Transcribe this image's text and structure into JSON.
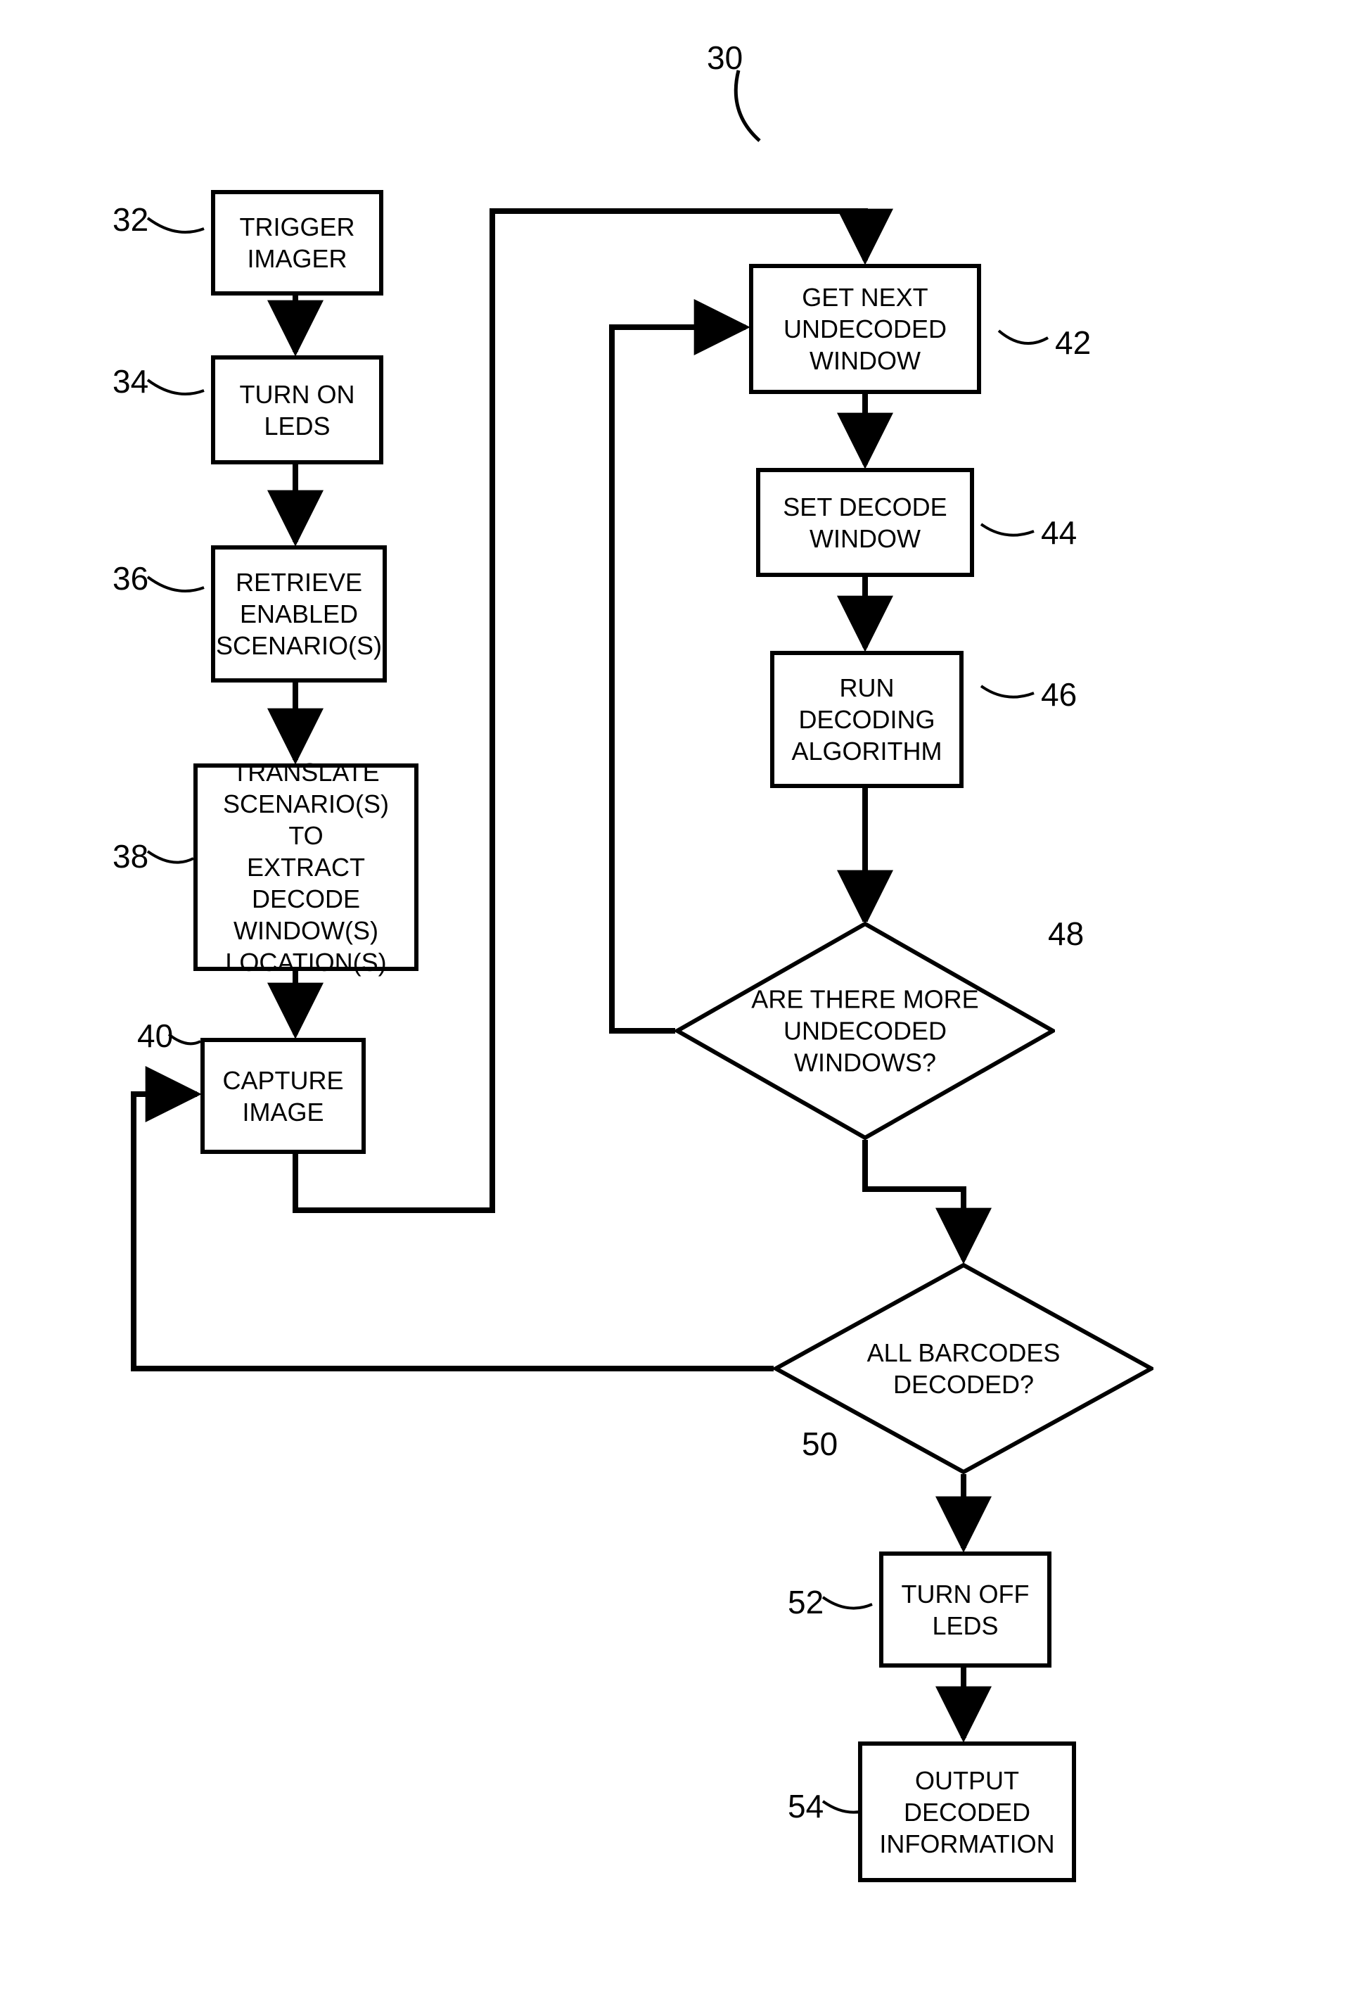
{
  "chart_data": {
    "type": "flowchart",
    "title_ref": "30",
    "nodes": [
      {
        "id": "n32",
        "ref": "32",
        "shape": "rect",
        "text": "TRIGGER IMAGER"
      },
      {
        "id": "n34",
        "ref": "34",
        "shape": "rect",
        "text": "TURN ON LEDS"
      },
      {
        "id": "n36",
        "ref": "36",
        "shape": "rect",
        "text": "RETRIEVE ENABLED SCENARIO(S)"
      },
      {
        "id": "n38",
        "ref": "38",
        "shape": "rect",
        "text": "TRANSLATE SCENARIO(S) TO EXTRACT DECODE WINDOW(S) LOCATION(S)"
      },
      {
        "id": "n40",
        "ref": "40",
        "shape": "rect",
        "text": "CAPTURE IMAGE"
      },
      {
        "id": "n42",
        "ref": "42",
        "shape": "rect",
        "text": "GET NEXT UNDECODED WINDOW"
      },
      {
        "id": "n44",
        "ref": "44",
        "shape": "rect",
        "text": "SET DECODE WINDOW"
      },
      {
        "id": "n46",
        "ref": "46",
        "shape": "rect",
        "text": "RUN DECODING ALGORITHM"
      },
      {
        "id": "n48",
        "ref": "48",
        "shape": "diamond",
        "text": "ARE THERE MORE UNDECODED WINDOWS?"
      },
      {
        "id": "n50",
        "ref": "50",
        "shape": "diamond",
        "text": "ALL BARCODES DECODED?"
      },
      {
        "id": "n52",
        "ref": "52",
        "shape": "rect",
        "text": "TURN OFF LEDS"
      },
      {
        "id": "n54",
        "ref": "54",
        "shape": "rect",
        "text": "OUTPUT DECODED INFORMATION"
      }
    ],
    "edges": [
      {
        "from": "n32",
        "to": "n34"
      },
      {
        "from": "n34",
        "to": "n36"
      },
      {
        "from": "n36",
        "to": "n38"
      },
      {
        "from": "n38",
        "to": "n40"
      },
      {
        "from": "n40",
        "to": "n42"
      },
      {
        "from": "n42",
        "to": "n44"
      },
      {
        "from": "n44",
        "to": "n46"
      },
      {
        "from": "n46",
        "to": "n48"
      },
      {
        "from": "n48",
        "to": "n42",
        "label": "yes-loop"
      },
      {
        "from": "n48",
        "to": "n50"
      },
      {
        "from": "n50",
        "to": "n40",
        "label": "no-loop"
      },
      {
        "from": "n50",
        "to": "n52"
      },
      {
        "from": "n52",
        "to": "n54"
      }
    ]
  },
  "nodes": {
    "n32": {
      "text": "TRIGGER\nIMAGER",
      "ref": "32"
    },
    "n34": {
      "text": "TURN ON\nLEDS",
      "ref": "34"
    },
    "n36": {
      "text": "RETRIEVE\nENABLED\nSCENARIO(S)",
      "ref": "36"
    },
    "n38": {
      "text": "TRANSLATE\nSCENARIO(S) TO\nEXTRACT DECODE\nWINDOW(S)\nLOCATION(S)",
      "ref": "38"
    },
    "n40": {
      "text": "CAPTURE\nIMAGE",
      "ref": "40"
    },
    "n42": {
      "text": "GET NEXT\nUNDECODED\nWINDOW",
      "ref": "42"
    },
    "n44": {
      "text": "SET DECODE\nWINDOW",
      "ref": "44"
    },
    "n46": {
      "text": "RUN\nDECODING\nALGORITHM",
      "ref": "46"
    },
    "n48": {
      "text": "ARE THERE MORE\nUNDECODED\nWINDOWS?",
      "ref": "48"
    },
    "n50": {
      "text": "ALL BARCODES\nDECODED?",
      "ref": "50"
    },
    "n52": {
      "text": "TURN OFF\nLEDS",
      "ref": "52"
    },
    "n54": {
      "text": "OUTPUT\nDECODED\nINFORMATION",
      "ref": "54"
    },
    "title": {
      "ref": "30"
    }
  }
}
